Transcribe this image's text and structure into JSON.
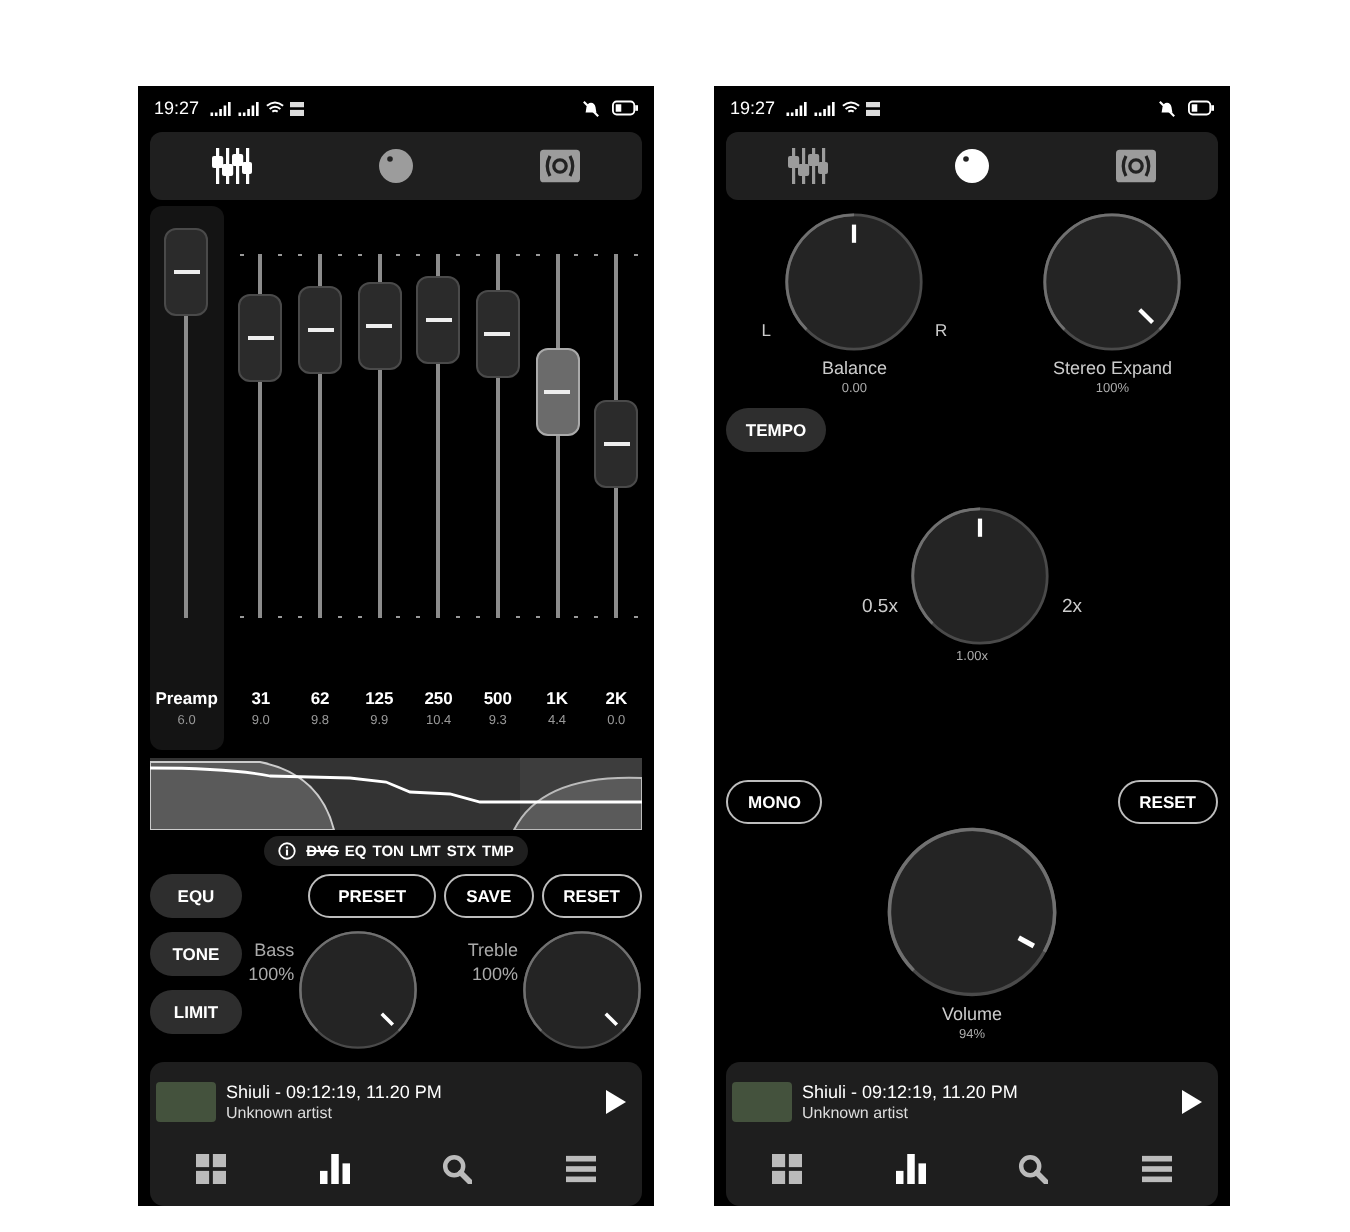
{
  "screens": [
    {
      "kind": "equalizer",
      "status_bar": {
        "time": "19:27"
      },
      "tabs": [
        {
          "kind": "equalizer",
          "selected": true
        },
        {
          "kind": "knob",
          "selected": false
        },
        {
          "kind": "speaker",
          "selected": false
        }
      ],
      "preamp": {
        "label": "Preamp",
        "value": "6.0",
        "level": 0.95
      },
      "bands": [
        {
          "label": "31",
          "value": "9.0",
          "level": 0.77,
          "selected": false
        },
        {
          "label": "62",
          "value": "9.8",
          "level": 0.79,
          "selected": false
        },
        {
          "label": "125",
          "value": "9.9",
          "level": 0.8,
          "selected": false
        },
        {
          "label": "250",
          "value": "10.4",
          "level": 0.82,
          "selected": false
        },
        {
          "label": "500",
          "value": "9.3",
          "level": 0.78,
          "selected": false
        },
        {
          "label": "1K",
          "value": "4.4",
          "level": 0.62,
          "selected": true
        },
        {
          "label": "2K",
          "value": "0.0",
          "level": 0.48,
          "selected": false
        }
      ],
      "modules": [
        {
          "label": "DVG",
          "on": false
        },
        {
          "label": "EQ",
          "on": true
        },
        {
          "label": "TON",
          "on": true
        },
        {
          "label": "LMT",
          "on": true
        },
        {
          "label": "STX",
          "on": true
        },
        {
          "label": "TMP",
          "on": true
        }
      ],
      "side_buttons": [
        "EQU",
        "TONE",
        "LIMIT"
      ],
      "actions": [
        "PRESET",
        "SAVE",
        "RESET"
      ],
      "knobs": [
        {
          "label": "Bass",
          "value": "100%",
          "level": 1
        },
        {
          "label": "Treble",
          "value": "100%",
          "level": 1
        }
      ],
      "now_playing": {
        "title": "Shiuli - 09:12:19, 11.20 PM",
        "artist": "Unknown artist"
      }
    },
    {
      "kind": "effects",
      "status_bar": {
        "time": "19:27"
      },
      "tabs": [
        {
          "kind": "equalizer",
          "selected": false
        },
        {
          "kind": "knob",
          "selected": true
        },
        {
          "kind": "speaker",
          "selected": false
        }
      ],
      "knobs": [
        {
          "label": "Balance",
          "value": "0.00",
          "level": 0.5,
          "left": "L",
          "right": "R"
        },
        {
          "label": "Stereo Expand",
          "value": "100%",
          "level": 1
        }
      ],
      "tempo_button": "TEMPO",
      "tempo": {
        "min": "0.5x",
        "max": "2x",
        "value": "1.00x",
        "level": 0.5
      },
      "buttons": [
        "MONO",
        "RESET"
      ],
      "volume": {
        "label": "Volume",
        "value": "94%",
        "level": 0.94
      },
      "now_playing": {
        "title": "Shiuli - 09:12:19, 11.20 PM",
        "artist": "Unknown artist"
      }
    }
  ]
}
